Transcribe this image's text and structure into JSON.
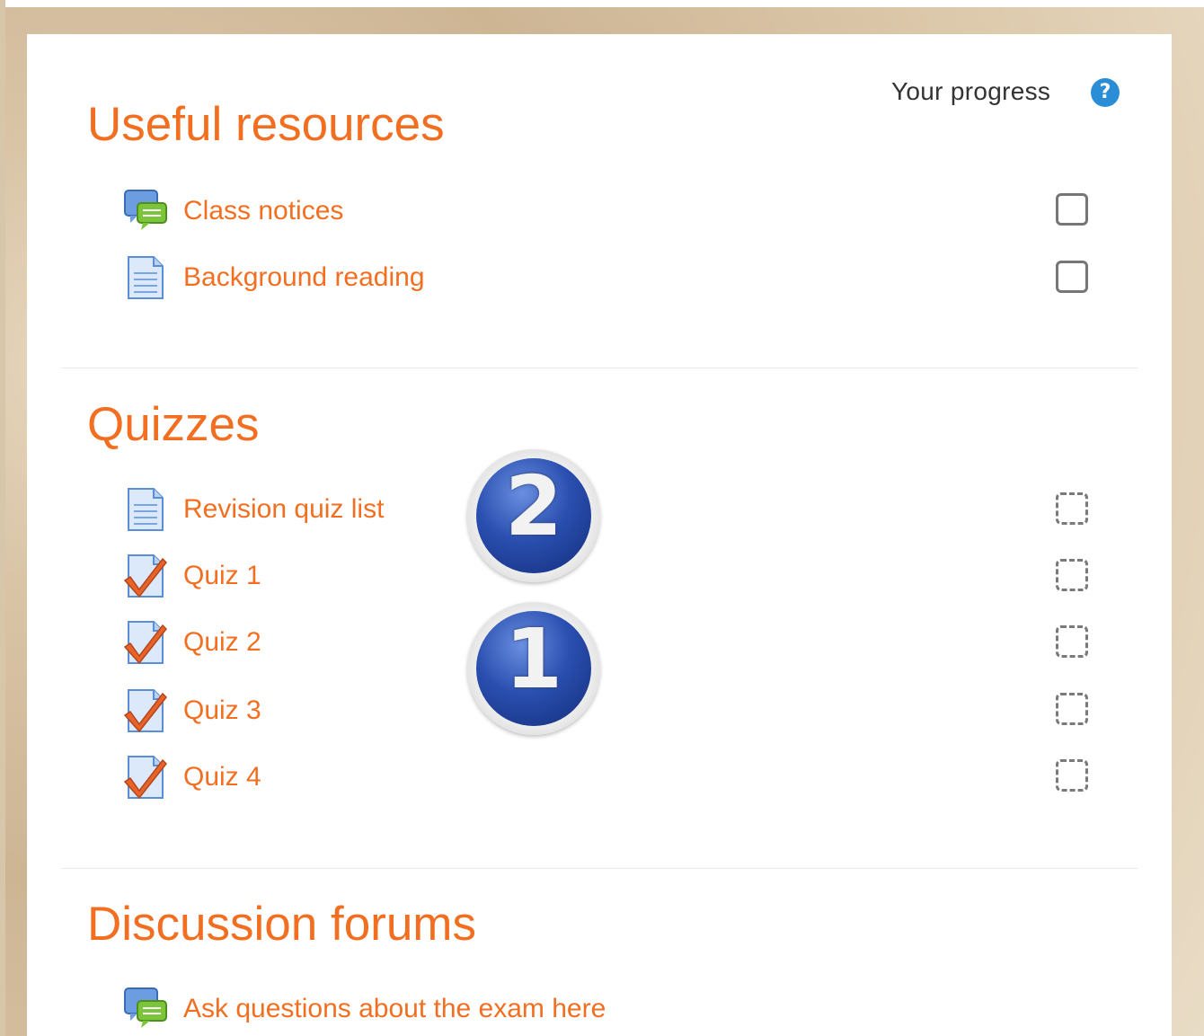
{
  "progress": {
    "label": "Your progress",
    "help_icon": "?"
  },
  "sections": [
    {
      "title": "Useful resources",
      "activities": [
        {
          "label": "Class notices",
          "icon": "forum-icon",
          "completion": "manual"
        },
        {
          "label": "Background reading",
          "icon": "page-icon",
          "completion": "manual"
        }
      ]
    },
    {
      "title": "Quizzes",
      "activities": [
        {
          "label": "Revision quiz list",
          "icon": "page-icon",
          "completion": "automatic"
        },
        {
          "label": "Quiz 1",
          "icon": "quiz-icon",
          "completion": "automatic"
        },
        {
          "label": "Quiz 2",
          "icon": "quiz-icon",
          "completion": "automatic"
        },
        {
          "label": "Quiz 3",
          "icon": "quiz-icon",
          "completion": "automatic"
        },
        {
          "label": "Quiz 4",
          "icon": "quiz-icon",
          "completion": "automatic"
        }
      ]
    },
    {
      "title": "Discussion forums",
      "activities": [
        {
          "label": "Ask questions about the exam here",
          "icon": "forum-icon",
          "completion": "none"
        }
      ]
    }
  ],
  "callouts": {
    "first": "1",
    "second": "2"
  },
  "colors": {
    "accent": "#f26f21",
    "help_blue": "#2a8ed6",
    "badge_blue": "#2a4fb0"
  }
}
